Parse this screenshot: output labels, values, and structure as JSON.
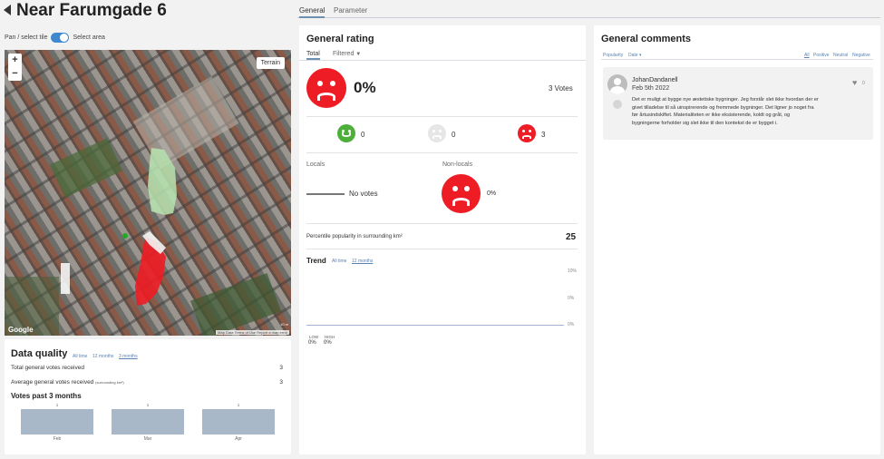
{
  "header": {
    "title": "Near Farumgade 6",
    "tabs": [
      {
        "label": "General",
        "active": true
      },
      {
        "label": "Parameter",
        "active": false
      }
    ]
  },
  "map_panel": {
    "pan_label": "Pan / select tile",
    "select_area_label": "Select area",
    "zoom_in": "+",
    "zoom_out": "−",
    "terrain_label": "Terrain",
    "google_label": "Google",
    "scale_label": "10 m",
    "attribution": "Map Data  Terms of Use  Report a map error"
  },
  "data_quality": {
    "title": "Data quality",
    "filters": [
      "All time",
      "12 months",
      "3 months"
    ],
    "total_votes_label": "Total general votes received",
    "total_votes_value": "3",
    "avg_votes_label": "Average general votes received",
    "avg_votes_note": "(surrounding km²)",
    "avg_votes_value": "3",
    "votes_past_title": "Votes past 3 months",
    "bars": [
      {
        "month": "Feb",
        "value": 1
      },
      {
        "month": "Mar",
        "value": 1
      },
      {
        "month": "Apr",
        "value": 1
      }
    ]
  },
  "general_rating": {
    "title": "General rating",
    "tab_total": "Total",
    "tab_filtered": "Filtered",
    "main_percent": "0%",
    "votes_label": "3 Votes",
    "counts": {
      "positive": "0",
      "neutral": "0",
      "negative": "3"
    },
    "locals_label": "Locals",
    "locals_value": "No votes",
    "nonlocals_label": "Non-locals",
    "nonlocals_percent": "0%",
    "percentile_label": "Percentile popularity in surrounding km²",
    "percentile_value": "25",
    "trend_title": "Trend",
    "trend_filters": [
      "All time",
      "12 months"
    ],
    "trend_axis": [
      "10%",
      "0%",
      "0%"
    ],
    "low_label": "LOW",
    "high_label": "HIGH",
    "low_value": "0%",
    "high_value": "0%",
    "colors": {
      "negative": "#ee1c24",
      "positive": "#4caf3a",
      "neutral": "#e0e0e0"
    }
  },
  "comments": {
    "title": "General comments",
    "sort_popularity": "Popularity",
    "sort_date": "Date",
    "filters": [
      "All",
      "Positive",
      "Neutral",
      "Negative"
    ],
    "items": [
      {
        "author": "JohanDandanell",
        "date": "Feb 5th 2022",
        "likes": "0",
        "text_lines": [
          "Det er muligt at bygge nye æstetiske bygninger. Jeg forstår slet ikke hvordan der er",
          "givet tilladelse til så uinspirerende og fremmede bygninger. Det ligner jo noget fra",
          "før årtusindskiftet. Materialiteten er ikke eksisterende, koldt og gråt, og",
          "bygningerne forholder sig slet ikke til den kontekst de er bygget i."
        ]
      }
    ]
  }
}
